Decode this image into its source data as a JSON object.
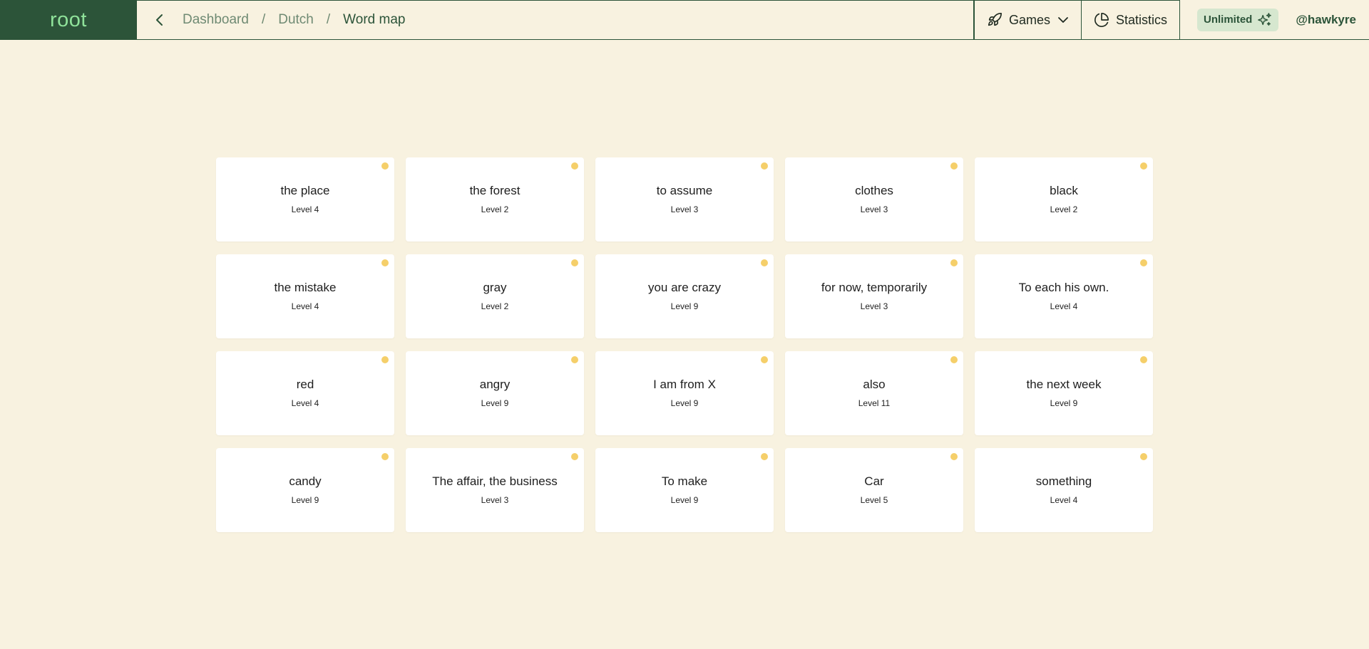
{
  "app": {
    "logo": "root"
  },
  "breadcrumb": [
    "Dashboard",
    "Dutch",
    "Word map"
  ],
  "nav": {
    "games_label": "Games",
    "stats_label": "Statistics"
  },
  "user": {
    "badge": "Unlimited",
    "handle": "@hawkyre"
  },
  "colors": {
    "brand": "#2c5439",
    "logo_text": "#8fe29a",
    "background": "#f8f2e0",
    "dot": "#f5cf6a"
  },
  "cards": [
    {
      "word": "the place",
      "level": "Level 4"
    },
    {
      "word": "the forest",
      "level": "Level 2"
    },
    {
      "word": "to assume",
      "level": "Level 3"
    },
    {
      "word": "clothes",
      "level": "Level 3"
    },
    {
      "word": "black",
      "level": "Level 2"
    },
    {
      "word": "the mistake",
      "level": "Level 4"
    },
    {
      "word": "gray",
      "level": "Level 2"
    },
    {
      "word": "you are crazy",
      "level": "Level 9"
    },
    {
      "word": "for now, temporarily",
      "level": "Level 3"
    },
    {
      "word": "To each his own.",
      "level": "Level 4"
    },
    {
      "word": "red",
      "level": "Level 4"
    },
    {
      "word": "angry",
      "level": "Level 9"
    },
    {
      "word": "I am from X",
      "level": "Level 9"
    },
    {
      "word": "also",
      "level": "Level 11"
    },
    {
      "word": "the next week",
      "level": "Level 9"
    },
    {
      "word": "candy",
      "level": "Level 9"
    },
    {
      "word": "The affair, the business",
      "level": "Level 3"
    },
    {
      "word": "To make",
      "level": "Level 9"
    },
    {
      "word": "Car",
      "level": "Level 5"
    },
    {
      "word": "something",
      "level": "Level 4"
    }
  ]
}
